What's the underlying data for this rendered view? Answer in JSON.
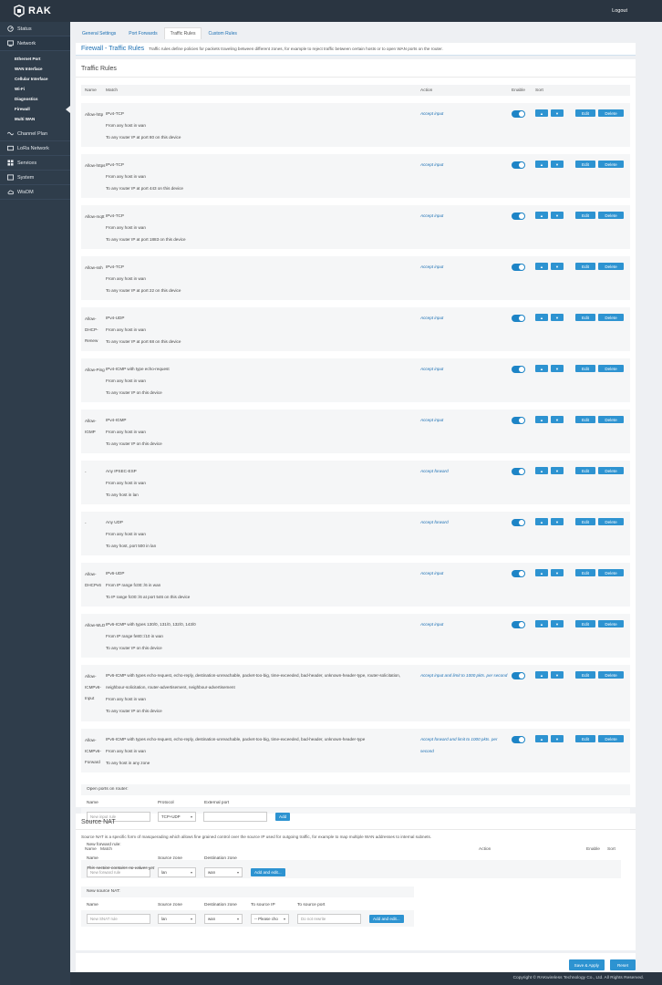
{
  "header": {
    "brand": "RAK",
    "logout": "Logout"
  },
  "sidebar": {
    "items": [
      {
        "label": "Status",
        "icon": "dashboard-icon"
      },
      {
        "label": "Network",
        "icon": "network-icon"
      }
    ],
    "network_sub": [
      "Ethernet Port",
      "WAN Interface",
      "Cellular Interface",
      "Wi-Fi",
      "Diagnostics",
      "Firewall",
      "Multi WAN"
    ],
    "items2": [
      {
        "label": "Channel Plan",
        "icon": "wave-icon"
      },
      {
        "label": "LoRa Network",
        "icon": "lora-icon"
      },
      {
        "label": "Services",
        "icon": "services-icon"
      },
      {
        "label": "System",
        "icon": "system-icon"
      },
      {
        "label": "WisDM",
        "icon": "cloud-icon"
      }
    ]
  },
  "tabs": [
    "General Settings",
    "Port Forwards",
    "Traffic Rules",
    "Custom Rules"
  ],
  "page": {
    "title": "Firewall - Traffic Rules",
    "description": "Traffic rules define policies for packets traveling between different zones, for example to reject traffic between certain hosts or to open WAN ports on the router."
  },
  "traffic_rules": {
    "title": "Traffic Rules",
    "columns": {
      "name": "Name",
      "match": "Match",
      "action": "Action",
      "enable": "Enable",
      "sort": "Sort"
    },
    "edit_label": "Edit",
    "delete_label": "Delete",
    "rules": [
      {
        "name": "Allow-http",
        "lines": [
          "IPv4-TCP",
          "From any host in wan",
          "To any router IP at port 80 on this device"
        ],
        "action": "Accept input",
        "height": 48
      },
      {
        "name": "Allow-https",
        "lines": [
          "IPv4-TCP",
          "From any host in wan",
          "To any router IP at port 443 on this device"
        ],
        "action": "Accept input",
        "height": 48
      },
      {
        "name": "Allow-mqtt",
        "lines": [
          "IPv4-TCP",
          "From any host in wan",
          "To any router IP at port 1883 on this device"
        ],
        "action": "Accept input",
        "height": 48
      },
      {
        "name": "Allow-ssh",
        "lines": [
          "IPv4-TCP",
          "From any host in wan",
          "To any router IP at port 22 on this device"
        ],
        "action": "Accept input",
        "height": 48
      },
      {
        "name": "Allow-DHCP-Renew",
        "lines": [
          "IPv4-UDP",
          "From any host in wan",
          "To any router IP at port 68 on this device"
        ],
        "action": "Accept input",
        "height": 48
      },
      {
        "name": "Allow-Ping",
        "lines": [
          "IPv4-ICMP with type echo-request",
          "From any host in wan",
          "To any router IP on this device"
        ],
        "action": "Accept input",
        "height": 48
      },
      {
        "name": "Allow-IGMP",
        "lines": [
          "IPv4-IGMP",
          "From any host in wan",
          "To any router IP on this device"
        ],
        "action": "Accept input",
        "height": 48
      },
      {
        "name": "-",
        "lines": [
          "Any IPSEC-ESP",
          "From any host in wan",
          "To any host in lan"
        ],
        "action": "Accept forward",
        "height": 48
      },
      {
        "name": "-",
        "lines": [
          "Any UDP",
          "From any host in wan",
          "To any host, port 500 in lan"
        ],
        "action": "Accept forward",
        "height": 48
      },
      {
        "name": "Allow-DHCPv6",
        "lines": [
          "IPv6-UDP",
          "From IP range fc00::/6 in wan",
          "To IP range fc00::/6 at port 546 on this device"
        ],
        "action": "Accept input",
        "height": 48
      },
      {
        "name": "Allow-MLD",
        "lines": [
          "IPv6-ICMP with types 130/0, 131/0, 132/0, 143/0",
          "From IP range fe80::/10 in wan",
          "To any router IP on this device"
        ],
        "action": "Accept input",
        "height": 48
      },
      {
        "name": "Allow-ICMPv6-Input",
        "lines": [
          "IPv6-ICMP with types echo-request, echo-reply, destination-unreachable, packet-too-big, time-exceeded, bad-header, unknown-header-type, router-solicitation,",
          "neighbour-solicitation, router-advertisement, neighbour-advertisement",
          "From any host in wan",
          "To any router IP on this device"
        ],
        "action": "Accept input and limit to 1000 pkts. per second",
        "height": 62
      },
      {
        "name": "Allow-ICMPv6-Forward",
        "lines": [
          "IPv6-ICMP with types echo-request, echo-reply, destination-unreachable, packet-too-big, time-exceeded, bad-header, unknown-header-type",
          "From any host in wan",
          "To any host in any zone"
        ],
        "action": "Accept forward and limit to 1000 pkts. per second",
        "height": 48
      }
    ]
  },
  "open_ports": {
    "title": "Open ports on router:",
    "labels": {
      "name": "Name",
      "protocol": "Protocol",
      "port": "External port"
    },
    "name_placeholder": "New input rule",
    "protocol_value": "TCP+UDP",
    "add_label": "Add"
  },
  "forward_rule": {
    "title": "New forward rule:",
    "labels": {
      "name": "Name",
      "source": "Source zone",
      "dest": "Destination zone"
    },
    "name_placeholder": "New forward rule",
    "source_value": "lan",
    "dest_value": "wan",
    "add_label": "Add and edit..."
  },
  "source_nat": {
    "title": "Source NAT",
    "description": "Source NAT is a specific form of masquerading which allows fine grained control over the source IP used for outgoing traffic, for example to map multiple WAN addresses to internal subnets.",
    "columns": {
      "name": "Name",
      "match": "Match",
      "action": "Action",
      "enable": "Enable",
      "sort": "Sort"
    },
    "empty": "This section contains no values yet",
    "new_title": "New source NAT:",
    "labels": {
      "name": "Name",
      "source": "Source zone",
      "dest": "Destination zone",
      "toip": "To source IP",
      "toport": "To source port"
    },
    "name_placeholder": "New SNAT rule",
    "source_value": "lan",
    "dest_value": "wan",
    "toip_value": "-- Please cho",
    "toport_placeholder": "Do not rewrite",
    "add_label": "Add and edit..."
  },
  "actions": {
    "save_apply": "Save & Apply",
    "reset": "Reset"
  },
  "footer": {
    "copyright": "Copyright © RAKwireless Technology Co., Ltd. All Rights Reserved."
  }
}
